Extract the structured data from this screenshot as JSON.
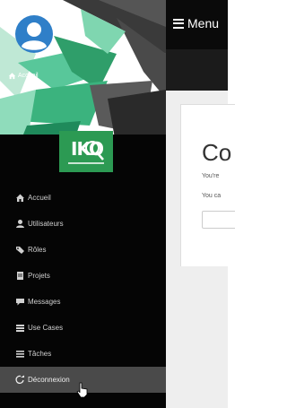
{
  "topbar": {
    "menu_label": "Menu",
    "menu_icon": "hamburger-icon"
  },
  "breadcrumb": {
    "home_label": "Accueil",
    "home_icon": "home-icon"
  },
  "sidebar": {
    "avatar_icon": "user-avatar-icon",
    "logo_text": "IKO",
    "items": [
      {
        "label": "Accueil",
        "icon": "home-icon"
      },
      {
        "label": "Utilisateurs",
        "icon": "user-icon"
      },
      {
        "label": "Rôles",
        "icon": "tags-icon"
      },
      {
        "label": "Projets",
        "icon": "document-icon"
      },
      {
        "label": "Messages",
        "icon": "comment-icon"
      },
      {
        "label": "Use Cases",
        "icon": "layers-icon"
      },
      {
        "label": "Tâches",
        "icon": "list-icon"
      },
      {
        "label": "Déconnexion",
        "icon": "logout-icon",
        "active": true
      }
    ]
  },
  "main": {
    "title": "Co",
    "line1": "You're",
    "line2": "You ca"
  },
  "colors": {
    "sidebar_bg": "#050505",
    "topbar_bg": "#0a0a0a",
    "accent_green": "#2c9a53",
    "avatar_blue": "#2f7fc8"
  }
}
